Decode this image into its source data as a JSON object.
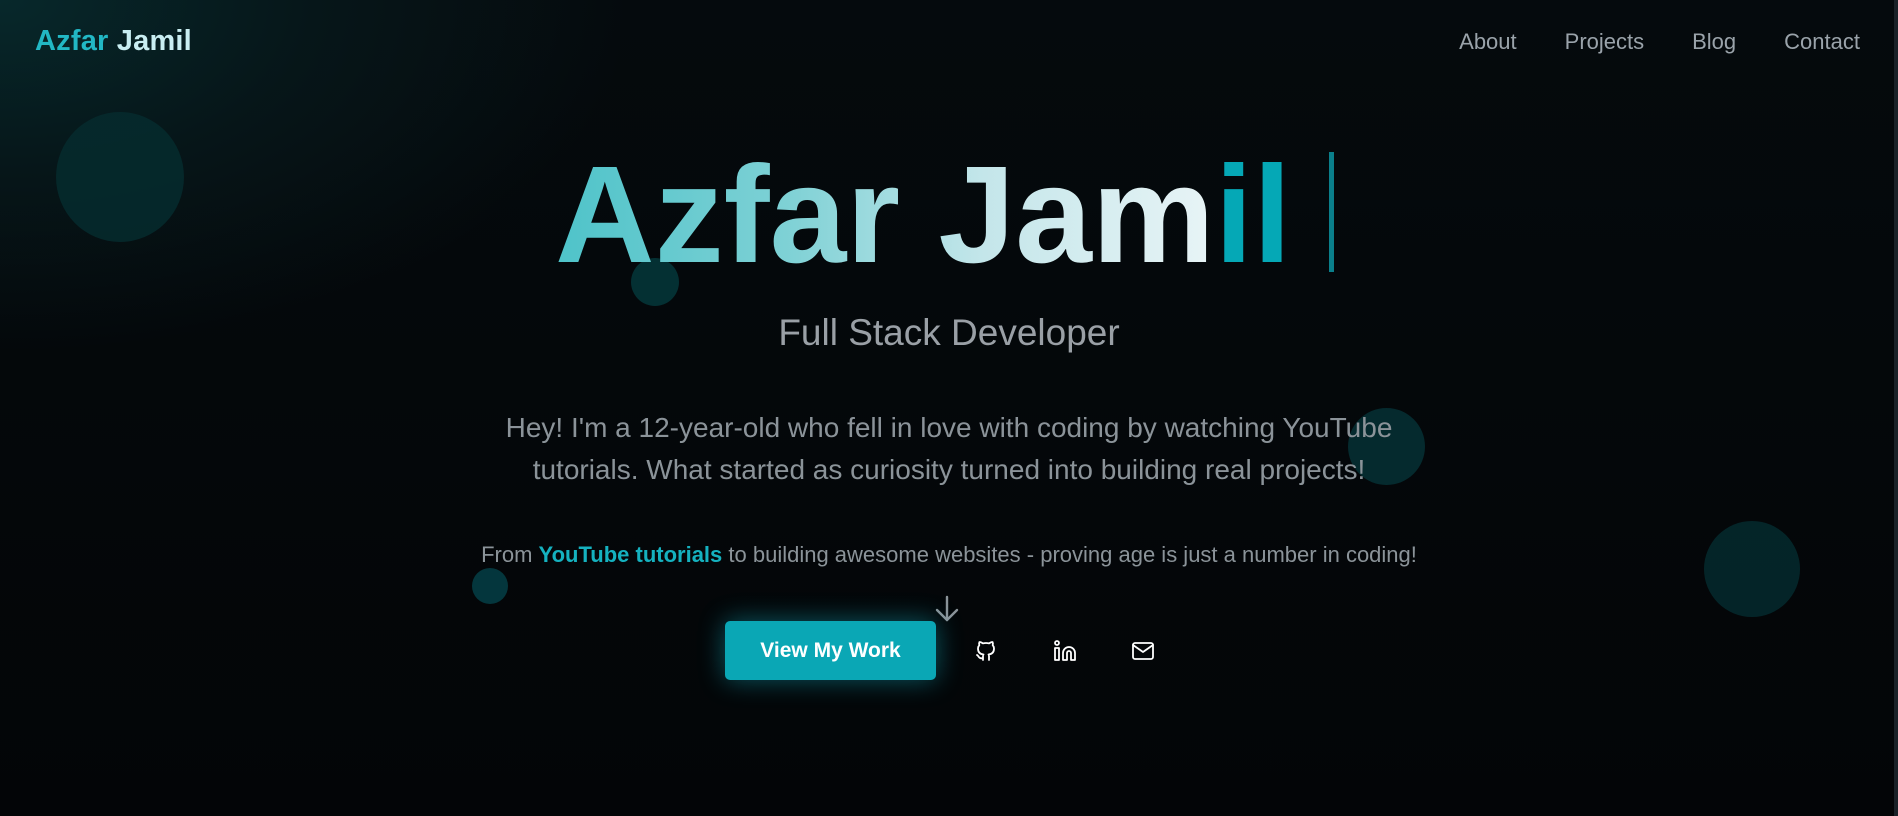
{
  "nav": {
    "brand_first": "Azfar",
    "brand_second": "Jamil",
    "links": [
      "About",
      "Projects",
      "Blog",
      "Contact"
    ]
  },
  "hero": {
    "title_gradient": "Azfar Jam",
    "title_typed": "il",
    "subtitle": "Full Stack Developer",
    "intro": "Hey! I'm a 12-year-old who fell in love with coding by watching YouTube tutorials. What started as curiosity turned into building real projects!",
    "tagline_prefix": "From ",
    "tagline_highlight": "YouTube tutorials",
    "tagline_suffix": " to building awesome websites - proving age is just a number in coding!",
    "cta_label": "View My Work"
  },
  "social": [
    {
      "icon": "github-icon"
    },
    {
      "icon": "linkedin-icon"
    },
    {
      "icon": "mail-icon"
    }
  ],
  "colors": {
    "accent": "#0aa7b5",
    "brand_teal": "#22b7c4",
    "background": "#04070a"
  }
}
